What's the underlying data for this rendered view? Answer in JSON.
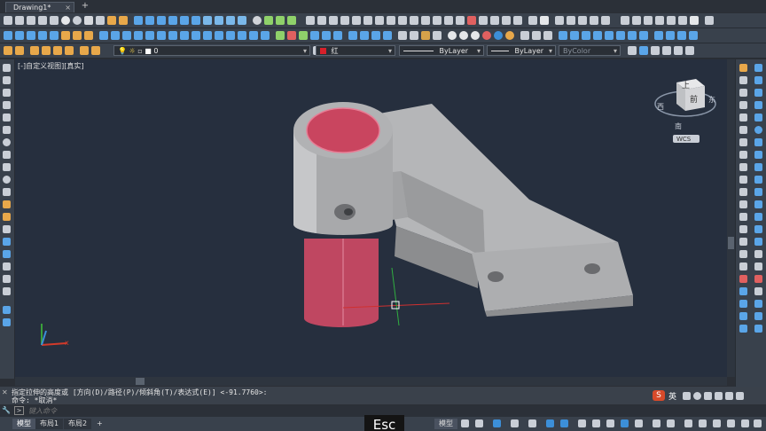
{
  "tabs": {
    "drawing": "Drawing1*",
    "close": "×",
    "add": "+"
  },
  "properties": {
    "layer": "0",
    "color": "红",
    "linetype": "ByLayer",
    "lineweight": "ByLayer",
    "plotstyle": "ByColor"
  },
  "viewport": {
    "label": "[-]自定义视图][真实]",
    "viewcube": {
      "top": "上",
      "front": "前",
      "west": "西",
      "east": "东",
      "south": "南",
      "wcs": "WCS"
    }
  },
  "command": {
    "prompt_line": "指定拉伸的高度或 [方向(D)/路径(P)/倾斜角(T)/表达式(E)] <-91.7760>:",
    "history_line": "命令: *取消*",
    "input_placeholder": "键入命令"
  },
  "status": {
    "tabs": [
      "模型",
      "布局1",
      "布局2"
    ],
    "add": "+",
    "model_button": "模型",
    "ime": "英",
    "key_overlay": "Esc"
  },
  "colors": {
    "background": "#262f3e",
    "model_gray": "#a9aaac",
    "face_red": "#c0405a",
    "accent": "#3c8fd8"
  }
}
